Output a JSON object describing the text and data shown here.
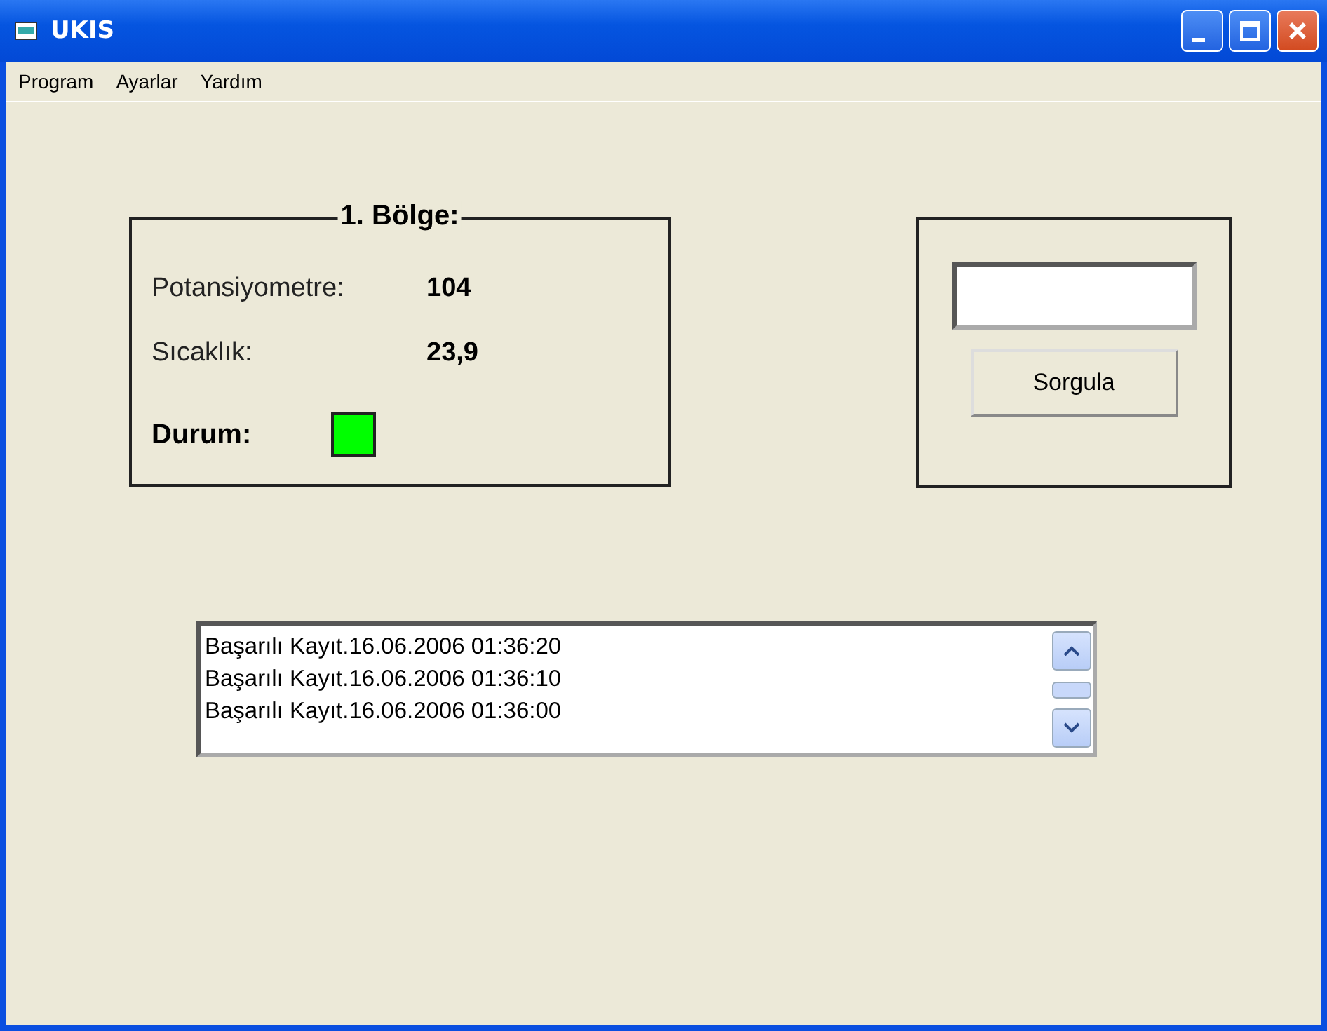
{
  "window": {
    "title": "UKIS"
  },
  "menu": [
    {
      "label": "Program"
    },
    {
      "label": "Ayarlar"
    },
    {
      "label": "Yardım"
    }
  ],
  "region": {
    "title": "1. Bölge:",
    "rows": [
      {
        "label": "Potansiyometre:",
        "value": "104"
      },
      {
        "label": "Sıcaklık:",
        "value": "23,9"
      }
    ],
    "status": {
      "label": "Durum:",
      "color": "#00ff00"
    }
  },
  "query": {
    "button": "Sorgula"
  },
  "log": {
    "items": [
      "Başarılı Kayıt.16.06.2006 01:36:20",
      "Başarılı Kayıt.16.06.2006 01:36:10",
      "Başarılı Kayıt.16.06.2006 01:36:00"
    ]
  }
}
